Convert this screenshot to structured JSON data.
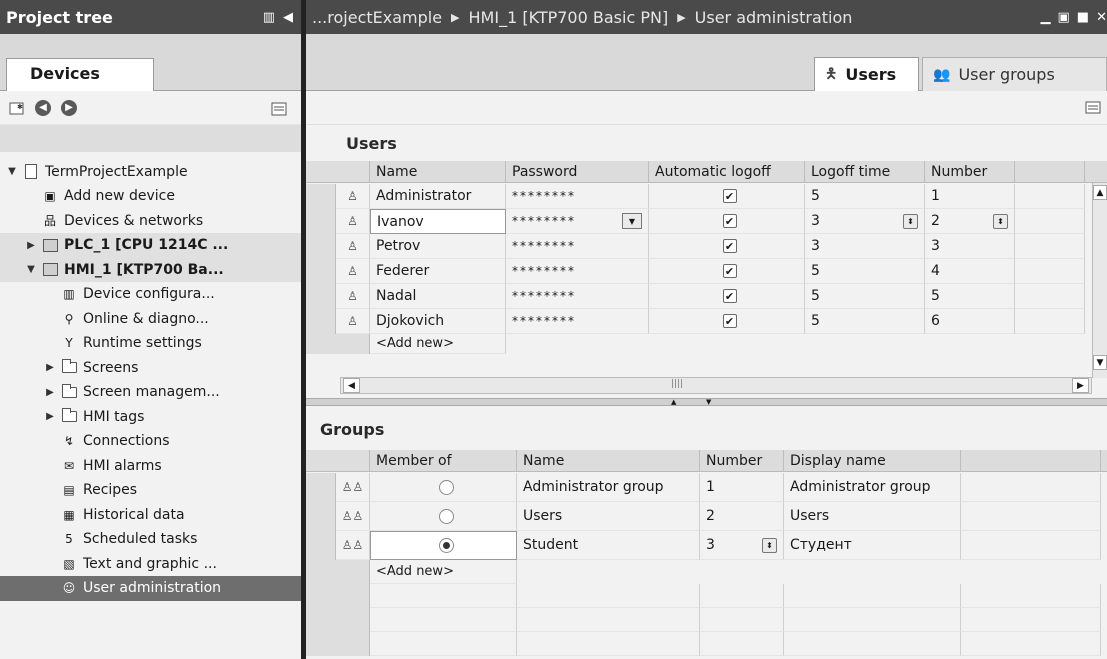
{
  "left": {
    "title": "Project tree",
    "devices_tab": "Devices",
    "tree": [
      {
        "label": "TermProjectExample",
        "icon": "doc-icon",
        "twisty": "▼",
        "indent": 0,
        "style": ""
      },
      {
        "label": "Add new device",
        "icon": "add-device-icon",
        "twisty": "",
        "indent": 1,
        "style": ""
      },
      {
        "label": "Devices & networks",
        "icon": "network-icon",
        "twisty": "",
        "indent": 1,
        "style": ""
      },
      {
        "label": "PLC_1 [CPU 1214C ...",
        "icon": "plc-icon",
        "twisty": "▶",
        "indent": 1,
        "style": "hl"
      },
      {
        "label": "HMI_1 [KTP700 Ba...",
        "icon": "hmi-icon",
        "twisty": "▼",
        "indent": 1,
        "style": "hl"
      },
      {
        "label": "Device configura...",
        "icon": "device-config-icon",
        "twisty": "",
        "indent": 2,
        "style": ""
      },
      {
        "label": "Online & diagno...",
        "icon": "diagnostics-icon",
        "twisty": "",
        "indent": 2,
        "style": ""
      },
      {
        "label": "Runtime settings",
        "icon": "runtime-settings-icon",
        "twisty": "",
        "indent": 2,
        "style": ""
      },
      {
        "label": "Screens",
        "icon": "folder-icon",
        "twisty": "▶",
        "indent": 2,
        "style": ""
      },
      {
        "label": "Screen managem...",
        "icon": "screen-management-icon",
        "twisty": "▶",
        "indent": 2,
        "style": ""
      },
      {
        "label": "HMI tags",
        "icon": "hmi-tags-icon",
        "twisty": "▶",
        "indent": 2,
        "style": ""
      },
      {
        "label": "Connections",
        "icon": "connections-icon",
        "twisty": "",
        "indent": 2,
        "style": ""
      },
      {
        "label": "HMI alarms",
        "icon": "alarm-icon",
        "twisty": "",
        "indent": 2,
        "style": ""
      },
      {
        "label": "Recipes",
        "icon": "recipes-icon",
        "twisty": "",
        "indent": 2,
        "style": ""
      },
      {
        "label": "Historical data",
        "icon": "historical-data-icon",
        "twisty": "",
        "indent": 2,
        "style": ""
      },
      {
        "label": "Scheduled tasks",
        "icon": "scheduled-tasks-icon",
        "twisty": "",
        "indent": 2,
        "style": ""
      },
      {
        "label": "Text and graphic ...",
        "icon": "text-graphic-icon",
        "twisty": "",
        "indent": 2,
        "style": ""
      },
      {
        "label": "User administration",
        "icon": "user-admin-icon",
        "twisty": "",
        "indent": 2,
        "style": "sel"
      }
    ]
  },
  "right": {
    "breadcrumb": [
      "...rojectExample",
      "HMI_1 [KTP700 Basic PN]",
      "User administration"
    ],
    "tab_users": "Users",
    "tab_groups": "User groups",
    "users_section": "Users",
    "users_columns": [
      "Name",
      "Password",
      "Automatic logoff",
      "Logoff time",
      "Number"
    ],
    "users": [
      {
        "name": "Administrator",
        "password": "********",
        "auto_logoff": "✔",
        "logoff_time": "5",
        "number": "1"
      },
      {
        "name": "Ivanov",
        "password": "********",
        "auto_logoff": "✔",
        "logoff_time": "3",
        "number": "2"
      },
      {
        "name": "Petrov",
        "password": "********",
        "auto_logoff": "✔",
        "logoff_time": "3",
        "number": "3"
      },
      {
        "name": "Federer",
        "password": "********",
        "auto_logoff": "✔",
        "logoff_time": "5",
        "number": "4"
      },
      {
        "name": "Nadal",
        "password": "********",
        "auto_logoff": "✔",
        "logoff_time": "5",
        "number": "5"
      },
      {
        "name": "Djokovich",
        "password": "********",
        "auto_logoff": "✔",
        "logoff_time": "5",
        "number": "6"
      }
    ],
    "users_add_new": "<Add new>",
    "groups_section": "Groups",
    "groups_columns": [
      "Member of",
      "Name",
      "Number",
      "Display name"
    ],
    "groups": [
      {
        "name": "Administrator group",
        "number": "1",
        "display": "Administrator group",
        "member": false
      },
      {
        "name": "Users",
        "number": "2",
        "display": "Users",
        "member": false
      },
      {
        "name": "Student",
        "number": "3",
        "display": "Студент",
        "member": true
      }
    ],
    "groups_add_new": "<Add new>"
  }
}
